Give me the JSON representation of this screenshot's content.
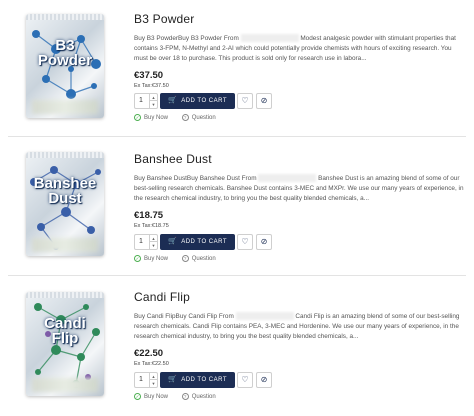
{
  "products": [
    {
      "pack_label": "B3\nPowder",
      "title": "B3 Powder",
      "desc_start": "Buy B3 PowderBuy B3 Powder From ",
      "desc_end": " Modest analgesic powder with stimulant properties that contains 3-FPM, N-Methyl and 2-AI which could potentially provide chemists with hours of exciting research. You must be over 18 to purchase. This product is sold only for research use in labora...",
      "price": "€37.50",
      "ex_tax": "Ex Tax:€37.50",
      "qty": "1",
      "add_to_cart": "ADD TO CART",
      "buy_now": "Buy Now",
      "question": "Question",
      "pack_tint": "#2c6fb5"
    },
    {
      "pack_label": "Banshee\nDust",
      "title": "Banshee Dust",
      "desc_start": "Buy Banshee DustBuy Banshee Dust From ",
      "desc_end": " Banshee Dust is an amazing blend of some of our best-selling research chemicals. Banshee Dust contains 3-MEC and MXPr. We use our many years of experience, in the research chemical industry, to bring you the best quality blended chemicals, a...",
      "price": "€18.75",
      "ex_tax": "Ex Tax:€18.75",
      "qty": "1",
      "add_to_cart": "ADD TO CART",
      "buy_now": "Buy Now",
      "question": "Question",
      "pack_tint": "#3a5fa8"
    },
    {
      "pack_label": "Candi\nFlip",
      "title": "Candi Flip",
      "desc_start": "Buy Candi FlipBuy Candi Flip From ",
      "desc_end": " Candi Flip is an amazing blend of some of our best-selling research chemicals. Candi Flip contains PEA, 3-MEC and Hordenine. We use our many years of experience, in the research chemical industry, to bring you the best quality blended chemicals, a...",
      "price": "€22.50",
      "ex_tax": "Ex Tax:€22.50",
      "qty": "1",
      "add_to_cart": "ADD TO CART",
      "buy_now": "Buy Now",
      "question": "Question",
      "pack_tint": "#2f8a5a"
    }
  ],
  "icons": {
    "wishlist": "heart-icon",
    "compare": "compare-icon",
    "cart": "cart-icon",
    "buy_now": "check-circle-icon",
    "question": "question-circle-icon"
  },
  "colors": {
    "button_bg": "#1c2d54",
    "buy_now": "#4caf50"
  }
}
